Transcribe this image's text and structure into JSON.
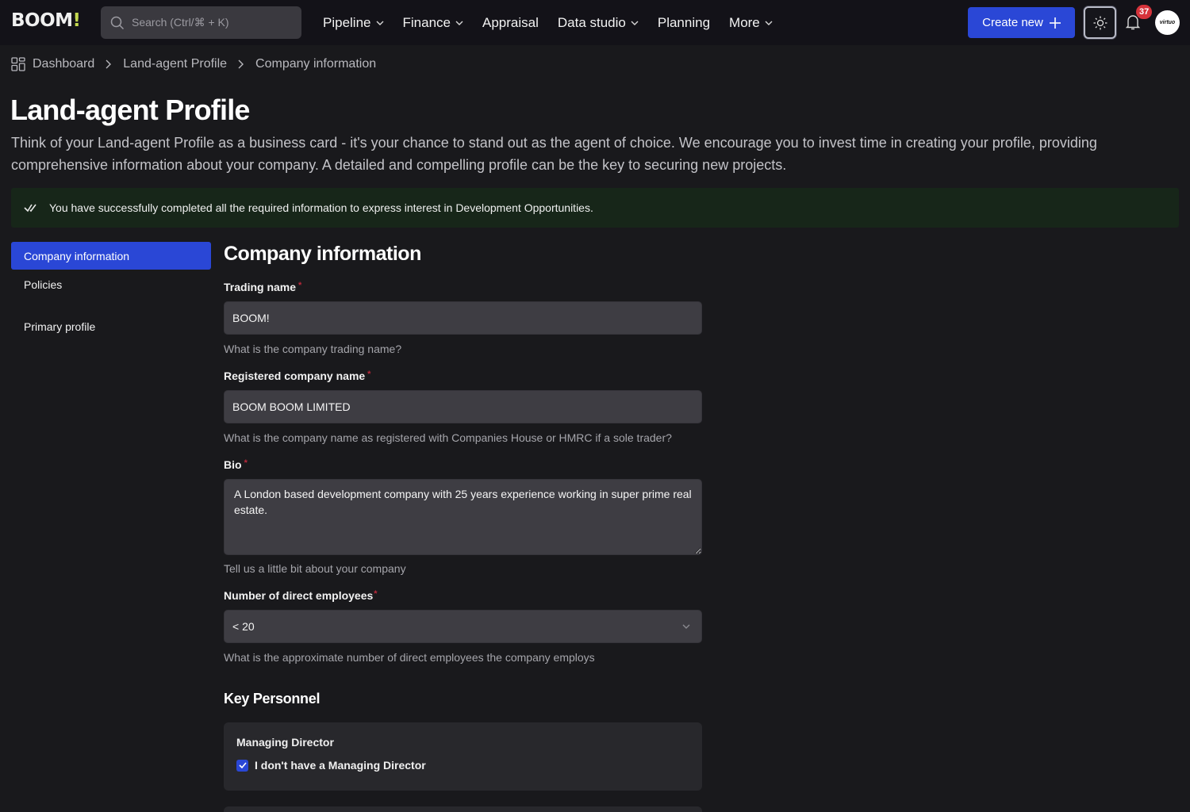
{
  "app": {
    "logo_text": "BOOM",
    "logo_mark": "!",
    "search_placeholder": "Search (Ctrl/⌘ + K)",
    "nav": [
      {
        "label": "Pipeline",
        "has_dropdown": true
      },
      {
        "label": "Finance",
        "has_dropdown": true
      },
      {
        "label": "Appraisal",
        "has_dropdown": false
      },
      {
        "label": "Data studio",
        "has_dropdown": true
      },
      {
        "label": "Planning",
        "has_dropdown": false
      },
      {
        "label": "More",
        "has_dropdown": true
      }
    ],
    "create_label": "Create new",
    "notifications_count": "37",
    "avatar_text": "virtuo",
    "accent_color": "#2a47d6",
    "badge_color": "#d6333b"
  },
  "breadcrumb": {
    "items": [
      "Dashboard",
      "Land-agent Profile",
      "Company information"
    ]
  },
  "page": {
    "title": "Land-agent Profile",
    "intro": "Think of your Land-agent Profile as a business card - it's your chance to stand out as the agent of choice. We encourage you to invest time in creating your profile, providing comprehensive information about your company. A detailed and compelling profile can be the key to securing new projects.",
    "success_message": "You have successfully completed all the required information to express interest in Development Opportunities."
  },
  "side_menu": {
    "items": [
      {
        "label": "Company information",
        "active": true
      },
      {
        "label": "Policies",
        "active": false
      },
      {
        "label": "Primary profile",
        "active": false
      }
    ]
  },
  "form": {
    "title": "Company information",
    "trading_name": {
      "label": "Trading name",
      "value": "BOOM!",
      "help": "What is the company trading name?",
      "required": "*"
    },
    "registered_name": {
      "label": "Registered company name",
      "value": "BOOM BOOM LIMITED",
      "help": "What is the company name as registered with Companies House or HMRC if a sole trader?",
      "required": "*"
    },
    "bio": {
      "label": "Bio",
      "value": "A London based development company with 25 years experience working in super prime real estate.",
      "help": "Tell us a little bit about your company",
      "required": "*"
    },
    "employees": {
      "label": "Number of direct employees",
      "value": "< 20",
      "help": "What is the approximate number of direct employees the company employs",
      "required": "*"
    },
    "key_personnel": {
      "title": "Key Personnel",
      "managing_director": {
        "title": "Managing Director",
        "checkbox_label": "I don't have a Managing Director",
        "checked": true
      }
    }
  }
}
